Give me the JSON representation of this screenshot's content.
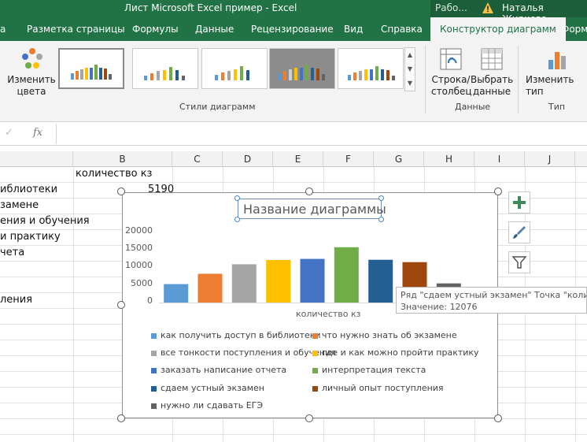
{
  "titlebar": {
    "doc_title": "Лист Microsoft Excel пример  -  Excel",
    "stage": "Рабо...",
    "user_name": "Наталья Жиркова"
  },
  "tabs": [
    {
      "label": "а"
    },
    {
      "label": "Разметка страницы"
    },
    {
      "label": "Формулы"
    },
    {
      "label": "Данные"
    },
    {
      "label": "Рецензирование"
    },
    {
      "label": "Вид"
    },
    {
      "label": "Справка"
    },
    {
      "label": "Конструктор диаграмм"
    },
    {
      "label": "Форм"
    }
  ],
  "ribbon": {
    "change_colors": "Изменить цвета",
    "styles_group": "Стили диаграмм",
    "switch_row_col": "Строка/ столбец",
    "select_data": "Выбрать данные",
    "data_group": "Данные",
    "change_type": "Изменить тип диаграммы",
    "type_group": "Тип"
  },
  "formula_bar": {
    "fx": "fx",
    "check": "✓"
  },
  "columns": [
    "B",
    "C",
    "D",
    "E",
    "F",
    "G",
    "H",
    "I",
    "J"
  ],
  "cells": {
    "b1": "количество кз",
    "b2": "5190",
    "a2": "иблиотеки",
    "a3": "замене",
    "a4": "ения и обучения",
    "a5": "и практику",
    "a6": "чета",
    "a9": "ления"
  },
  "chart_data": {
    "type": "bar",
    "title": "Название диаграммы",
    "xlabel": "количество кз",
    "ylim": [
      0,
      20000
    ],
    "yticks": [
      "20000",
      "15000",
      "10000",
      "5000",
      "0"
    ],
    "series": [
      {
        "name": "как получить доступ в библиотеки",
        "value": 5190,
        "color": "#5b9bd5"
      },
      {
        "name": "что нужно знать об экзамене",
        "value": 8100,
        "color": "#ed7d31"
      },
      {
        "name": "все тонкости поступления и обучения",
        "value": 10800,
        "color": "#a5a5a5"
      },
      {
        "name": "где и как можно пройти практику",
        "value": 12000,
        "color": "#ffc000"
      },
      {
        "name": "заказать написание отчета",
        "value": 12300,
        "color": "#4472c4"
      },
      {
        "name": "интерпретация текста",
        "value": 15600,
        "color": "#70ad47"
      },
      {
        "name": "сдаем устный экзамен",
        "value": 12076,
        "color": "#255e91"
      },
      {
        "name": "личный опыт поступления",
        "value": 11400,
        "color": "#9e480e"
      },
      {
        "name": "нужно ли сдавать ЕГЭ",
        "value": 5400,
        "color": "#636363"
      }
    ]
  },
  "tooltip": {
    "line1": "Ряд \"сдаем устный экзамен\" Точка \"количе",
    "line2": "Значение: 12076"
  }
}
